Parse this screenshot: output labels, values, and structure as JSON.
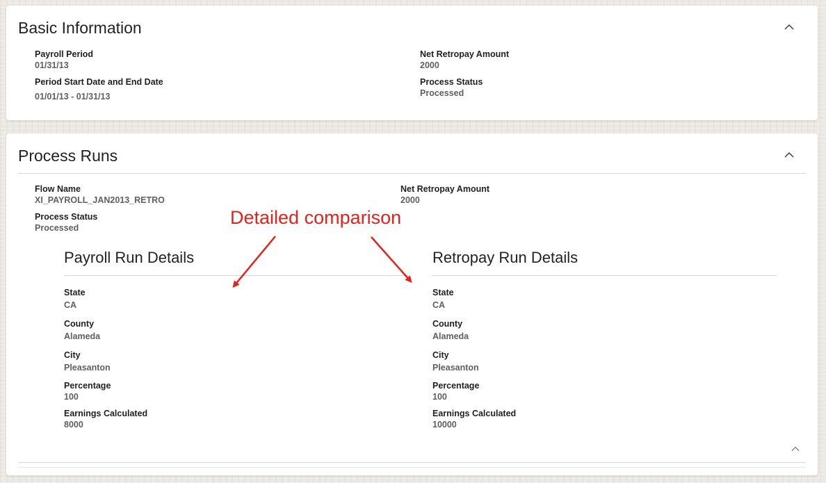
{
  "basic_info": {
    "title": "Basic Information",
    "payroll_period_label": "Payroll Period",
    "payroll_period_value": "01/31/13",
    "period_dates_label": "Period Start Date and End Date",
    "period_dates_value": "01/01/13 - 01/31/13",
    "net_retropay_label": "Net Retropay Amount",
    "net_retropay_value": "2000",
    "process_status_label": "Process Status",
    "process_status_value": "Processed"
  },
  "process_runs": {
    "title": "Process Runs",
    "flow_name_label": "Flow Name",
    "flow_name_value": "XI_PAYROLL_JAN2013_RETRO",
    "net_retropay_label": "Net Retropay Amount",
    "net_retropay_value": "2000",
    "process_status_label": "Process Status",
    "process_status_value": "Processed",
    "payroll_run": {
      "title": "Payroll Run Details",
      "fields": [
        {
          "label": "State",
          "value": "CA"
        },
        {
          "label": "County",
          "value": "Alameda"
        },
        {
          "label": "City",
          "value": "Pleasanton"
        },
        {
          "label": "Percentage",
          "value": "100"
        },
        {
          "label": "Earnings Calculated",
          "value": "8000"
        }
      ]
    },
    "retropay_run": {
      "title": "Retropay Run Details",
      "fields": [
        {
          "label": "State",
          "value": "CA"
        },
        {
          "label": "County",
          "value": "Alameda"
        },
        {
          "label": "City",
          "value": "Pleasanton"
        },
        {
          "label": "Percentage",
          "value": "100"
        },
        {
          "label": "Earnings Calculated",
          "value": "10000"
        }
      ]
    }
  },
  "annotation": {
    "text": "Detailed comparison",
    "color": "#e8201a"
  },
  "icons": {
    "collapse": "chevron-up-icon"
  }
}
